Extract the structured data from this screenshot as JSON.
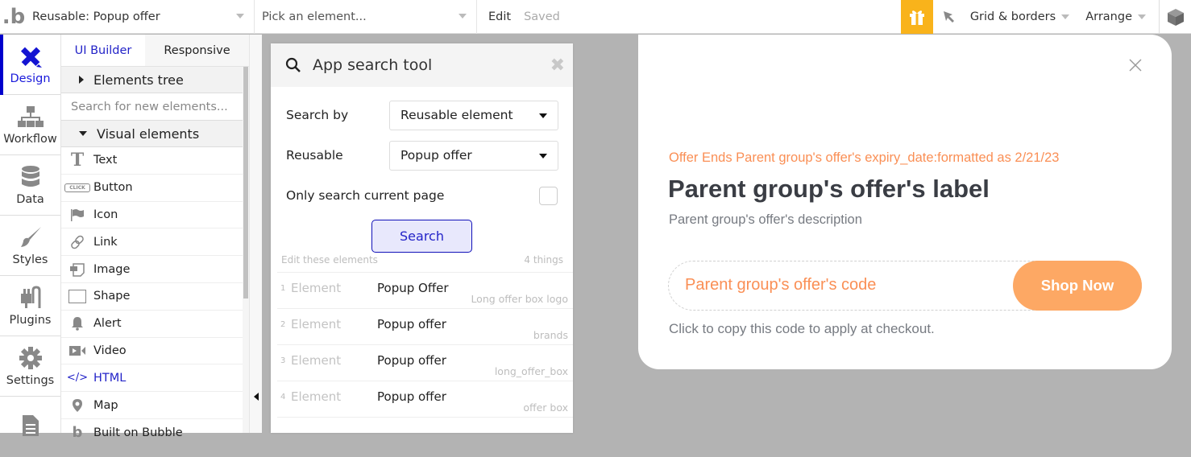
{
  "topbar": {
    "logo": ".b",
    "reusable_select": "Reusable: Popup offer",
    "element_picker_placeholder": "Pick an element...",
    "edit_label": "Edit",
    "saved_label": "Saved",
    "grid_label": "Grid & borders",
    "arrange_label": "Arrange",
    "gift_color": "#f9b31b"
  },
  "leftnav": {
    "items": [
      {
        "label": "Design",
        "icon": "design-icon",
        "active": true
      },
      {
        "label": "Workflow",
        "icon": "workflow-icon"
      },
      {
        "label": "Data",
        "icon": "database-icon"
      },
      {
        "label": "Styles",
        "icon": "brush-icon"
      },
      {
        "label": "Plugins",
        "icon": "plug-icon"
      },
      {
        "label": "Settings",
        "icon": "gear-icon"
      },
      {
        "label": "",
        "icon": "document-icon"
      }
    ]
  },
  "palette": {
    "tabs": [
      "UI Builder",
      "Responsive"
    ],
    "elements_tree": "Elements tree",
    "search_placeholder": "Search for new elements...",
    "visual_elements": "Visual elements",
    "items": [
      {
        "label": "Text",
        "icon": "text-icon"
      },
      {
        "label": "Button",
        "icon": "button-icon"
      },
      {
        "label": "Icon",
        "icon": "flag-icon"
      },
      {
        "label": "Link",
        "icon": "link-icon"
      },
      {
        "label": "Image",
        "icon": "image-icon"
      },
      {
        "label": "Shape",
        "icon": "shape-icon"
      },
      {
        "label": "Alert",
        "icon": "bell-icon"
      },
      {
        "label": "Video",
        "icon": "video-icon"
      },
      {
        "label": "HTML",
        "icon": "code-icon"
      },
      {
        "label": "Map",
        "icon": "map-pin-icon"
      },
      {
        "label": "Built on Bubble",
        "icon": "bubble-logo-icon"
      }
    ]
  },
  "search_tool": {
    "title": "App search tool",
    "search_by_label": "Search by",
    "search_by_value": "Reusable element",
    "reusable_label": "Reusable",
    "reusable_value": "Popup offer",
    "current_page_label": "Only search current page",
    "current_page_checked": false,
    "search_button": "Search",
    "results_label": "Edit these elements",
    "results_count": "4 things",
    "results": [
      {
        "num": "1",
        "kind": "Element",
        "name": "Popup Offer",
        "sub": "Long offer box logo"
      },
      {
        "num": "2",
        "kind": "Element",
        "name": "Popup offer",
        "sub": "brands"
      },
      {
        "num": "3",
        "kind": "Element",
        "name": "Popup offer",
        "sub": "long_offer_box"
      },
      {
        "num": "4",
        "kind": "Element",
        "name": "Popup offer",
        "sub": "offer box"
      }
    ]
  },
  "popup": {
    "expiry": "Offer Ends Parent group's offer's expiry_date:formatted as 2/21/23",
    "label": "Parent group's offer's label",
    "description": "Parent group's offer's description",
    "code": "Parent group's offer's code",
    "shop_button": "Shop Now",
    "copy_hint": "Click to copy this code to apply at checkout.",
    "accent_color": "#fa8f55",
    "button_color": "#fda864"
  }
}
